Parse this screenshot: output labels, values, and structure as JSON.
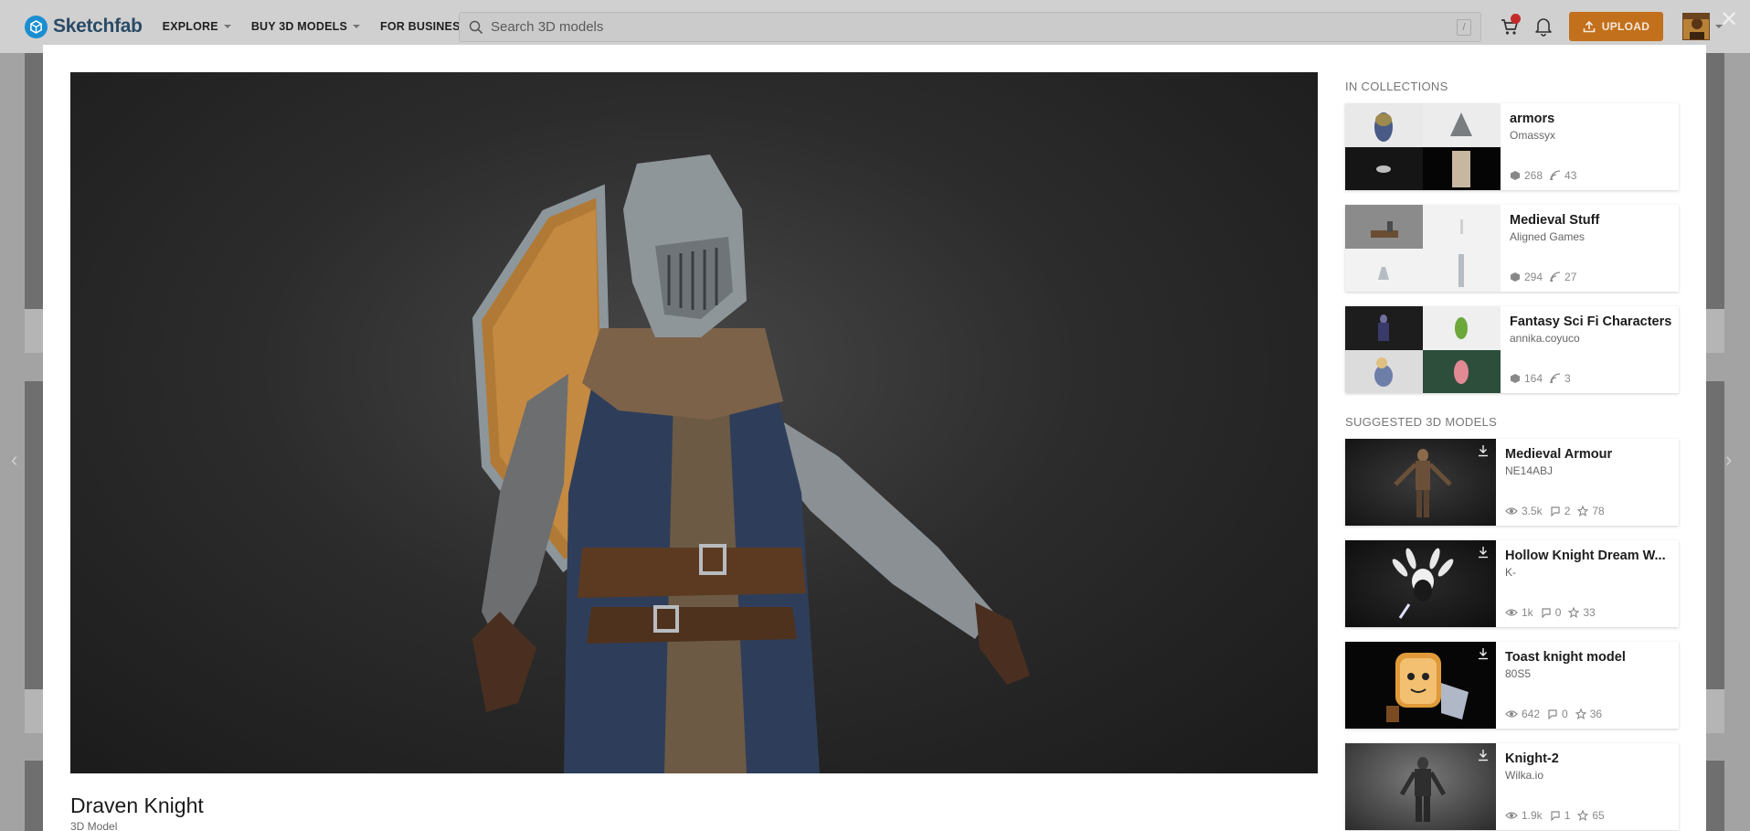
{
  "app": {
    "name": "Sketchfab"
  },
  "nav": {
    "items": [
      {
        "label": "EXPLORE"
      },
      {
        "label": "BUY 3D MODELS"
      },
      {
        "label": "FOR BUSINESS"
      }
    ],
    "search_placeholder": "Search 3D models",
    "search_shortcut": "/",
    "cart_count": "",
    "upload_label": "UPLOAD"
  },
  "model": {
    "title": "Draven Knight",
    "type": "3D Model"
  },
  "collections": {
    "heading": "IN COLLECTIONS",
    "items": [
      {
        "title": "armors",
        "author": "Omassyx",
        "models": "268",
        "followers": "43"
      },
      {
        "title": "Medieval Stuff",
        "author": "Aligned Games",
        "models": "294",
        "followers": "27"
      },
      {
        "title": "Fantasy Sci Fi Characters",
        "author": "annika.coyuco",
        "models": "164",
        "followers": "3"
      }
    ]
  },
  "suggested": {
    "heading": "SUGGESTED 3D MODELS",
    "items": [
      {
        "title": "Medieval Armour",
        "author": "NE14ABJ",
        "views": "3.5k",
        "comments": "2",
        "likes": "78"
      },
      {
        "title": "Hollow Knight Dream W...",
        "author": "K-",
        "views": "1k",
        "comments": "0",
        "likes": "33"
      },
      {
        "title": "Toast knight model",
        "author": "80S5",
        "views": "642",
        "comments": "0",
        "likes": "36"
      },
      {
        "title": "Knight-2",
        "author": "Wilka.io",
        "views": "1.9k",
        "comments": "1",
        "likes": "65"
      }
    ]
  },
  "colors": {
    "accent_upload": "#c2701b",
    "logo_blue": "#1a8ed1",
    "viewer_bg": "#2c2c2c"
  }
}
